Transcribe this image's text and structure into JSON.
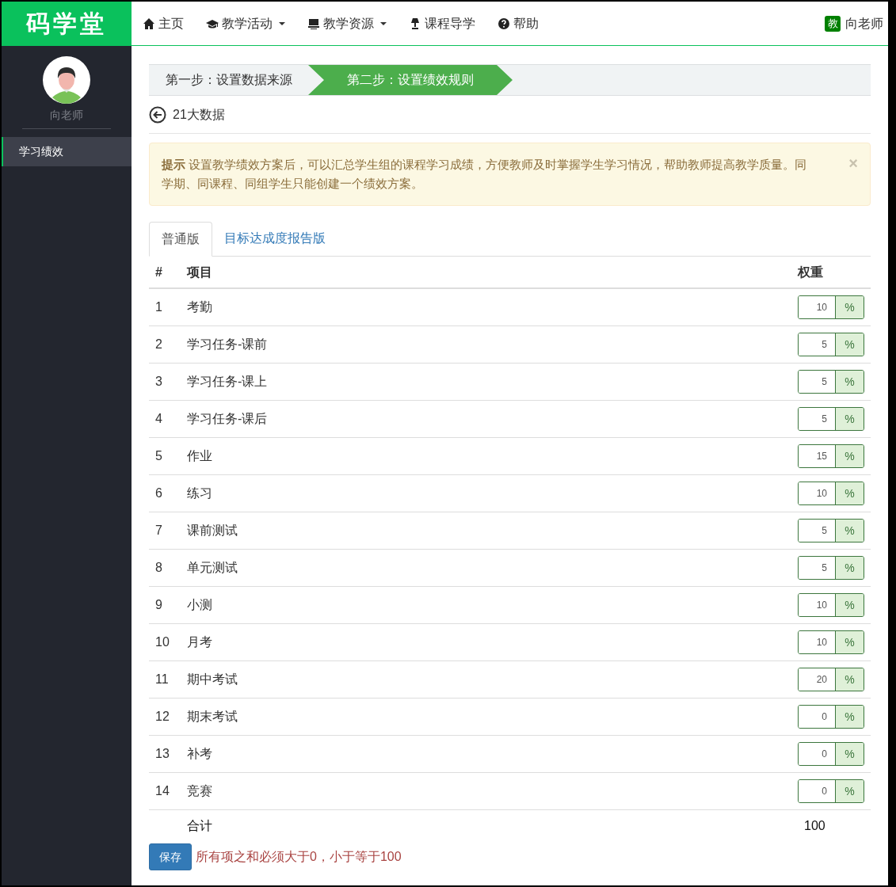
{
  "logo": "码学堂",
  "nav": [
    {
      "label": "主页",
      "kind": "home",
      "dropdown": false
    },
    {
      "label": "教学活动",
      "kind": "cap",
      "dropdown": true
    },
    {
      "label": "教学资源",
      "kind": "monitor",
      "dropdown": true
    },
    {
      "label": "课程导学",
      "kind": "lamp",
      "dropdown": false
    },
    {
      "label": "帮助",
      "kind": "help",
      "dropdown": false
    }
  ],
  "user": {
    "badge": "教",
    "name": "向老师"
  },
  "sidebar": {
    "user_name": "向老师",
    "items": [
      {
        "label": "学习绩效",
        "selected": true
      }
    ]
  },
  "steps": [
    {
      "label": "第一步：设置数据来源",
      "selected": false
    },
    {
      "label": "第二步：设置绩效规则",
      "selected": true
    }
  ],
  "back_title": "21大数据",
  "alert": {
    "title": "提示",
    "text": "设置教学绩效方案后，可以汇总学生组的课程学习成绩，方便教师及时掌握学生学习情况，帮助教师提高教学质量。同学期、同课程、同组学生只能创建一个绩效方案。",
    "close": "×"
  },
  "tabs": [
    {
      "label": "普通版",
      "selected": true
    },
    {
      "label": "目标达成度报告版",
      "selected": false
    }
  ],
  "table": {
    "columns": [
      "#",
      "项目",
      "权重"
    ],
    "rows": [
      {
        "index": "1",
        "item": "考勤",
        "weight": "10",
        "unit": "%"
      },
      {
        "index": "2",
        "item": "学习任务-课前",
        "weight": "5",
        "unit": "%"
      },
      {
        "index": "3",
        "item": "学习任务-课上",
        "weight": "5",
        "unit": "%"
      },
      {
        "index": "4",
        "item": "学习任务-课后",
        "weight": "5",
        "unit": "%"
      },
      {
        "index": "5",
        "item": "作业",
        "weight": "15",
        "unit": "%"
      },
      {
        "index": "6",
        "item": "练习",
        "weight": "10",
        "unit": "%"
      },
      {
        "index": "7",
        "item": "课前测试",
        "weight": "5",
        "unit": "%"
      },
      {
        "index": "8",
        "item": "单元测试",
        "weight": "5",
        "unit": "%"
      },
      {
        "index": "9",
        "item": "小测",
        "weight": "10",
        "unit": "%"
      },
      {
        "index": "10",
        "item": "月考",
        "weight": "10",
        "unit": "%"
      },
      {
        "index": "11",
        "item": "期中考试",
        "weight": "20",
        "unit": "%"
      },
      {
        "index": "12",
        "item": "期末考试",
        "weight": "0",
        "unit": "%"
      },
      {
        "index": "13",
        "item": "补考",
        "weight": "0",
        "unit": "%"
      },
      {
        "index": "14",
        "item": "竞赛",
        "weight": "0",
        "unit": "%"
      }
    ],
    "total": {
      "label": "合计",
      "value": "100"
    }
  },
  "save_button": "保存",
  "error": "所有项之和必须大于0，小于等于100"
}
